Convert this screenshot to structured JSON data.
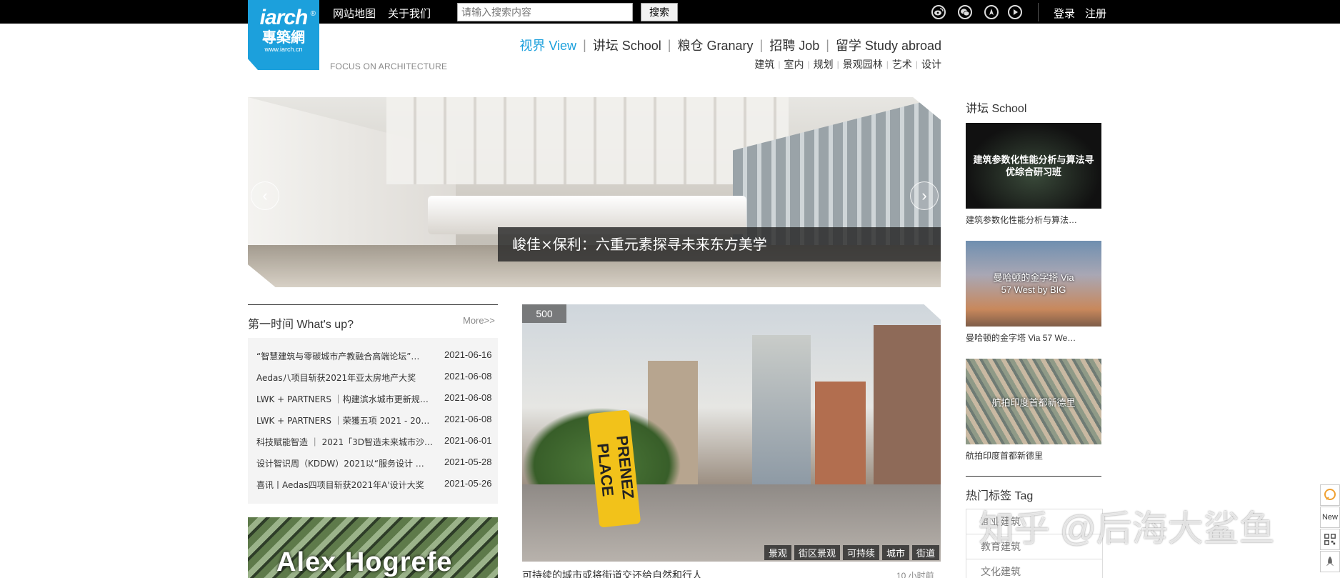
{
  "topbar": {
    "links": [
      "网站地图",
      "关于我们"
    ],
    "search_placeholder": "请输入搜索内容",
    "search_button": "搜索",
    "login": "登录",
    "register": "注册"
  },
  "logo": {
    "line1": "iarch",
    "line2": "專築網",
    "line3": "www.iarch.cn",
    "reg": "®",
    "tagline": "FOCUS ON ARCHITECTURE"
  },
  "nav": {
    "main": [
      "视界 View",
      "讲坛 School",
      "粮仓 Granary",
      "招聘 Job",
      "留学 Study abroad"
    ],
    "sep": "|",
    "sub": [
      "建筑",
      "室内",
      "规划",
      "景观园林",
      "艺术",
      "设计"
    ],
    "sub_sep": "|"
  },
  "hero": {
    "caption": "峻佳×保利：六重元素探寻未来东方美学",
    "prev": "‹",
    "next": "›"
  },
  "sidebar": {
    "school_title": "讲坛 School",
    "items": [
      {
        "overlay": "建筑参数化性能分析与算法寻优综合研习班",
        "caption": "建筑参数化性能分析与算法…"
      },
      {
        "overlay": "曼哈顿的金字塔 Via 57 West by BIG",
        "caption": "曼哈顿的金字塔 Via 57 We…"
      },
      {
        "overlay": "航拍印度首都新德里",
        "caption": "航拍印度首都新德里"
      }
    ],
    "tag_title": "热门标签 Tag",
    "tags": [
      "商业建筑",
      "教育建筑",
      "文化建筑"
    ]
  },
  "whatsup": {
    "title": "第一时间 What's up?",
    "more": "More>>",
    "items": [
      {
        "title": "“智慧建筑与零碳城市产教融合高端论坛”…",
        "date": "2021-06-16"
      },
      {
        "title": "Aedas八项目斩获2021年亚太房地产大奖",
        "date": "2021-06-08"
      },
      {
        "title": "LWK + PARTNERS ｜构建滨水城市更新规划…",
        "date": "2021-06-08"
      },
      {
        "title": "LWK + PARTNERS ｜荣獲五项 2021 - 2022 …",
        "date": "2021-06-08"
      },
      {
        "title": "科技赋能智造 ｜ 2021「3D智造未来城市沙…",
        "date": "2021-06-01"
      },
      {
        "title": "设计智识周（KDDW）2021以“服务设计 …",
        "date": "2021-05-28"
      },
      {
        "title": "喜讯丨Aedas四项目斩获2021年A'设计大奖",
        "date": "2021-05-26"
      }
    ]
  },
  "promo": {
    "text": "Alex Hogrefe"
  },
  "feature": {
    "count": "500",
    "sign_text": "PRENEZ PLACE",
    "tags": [
      "景观",
      "街区景观",
      "可持续",
      "城市",
      "街道"
    ],
    "caption": "可持续的城市或将街道交还给自然和行人",
    "time": "10 小时前"
  },
  "watermark": "知乎 @后海大鲨鱼",
  "float_widgets": [
    "New"
  ],
  "colors": {
    "accent": "#1ca0dc",
    "topbar": "#000000"
  },
  "icons": [
    "weibo-icon",
    "wechat-icon",
    "lotus-icon",
    "play-icon"
  ]
}
